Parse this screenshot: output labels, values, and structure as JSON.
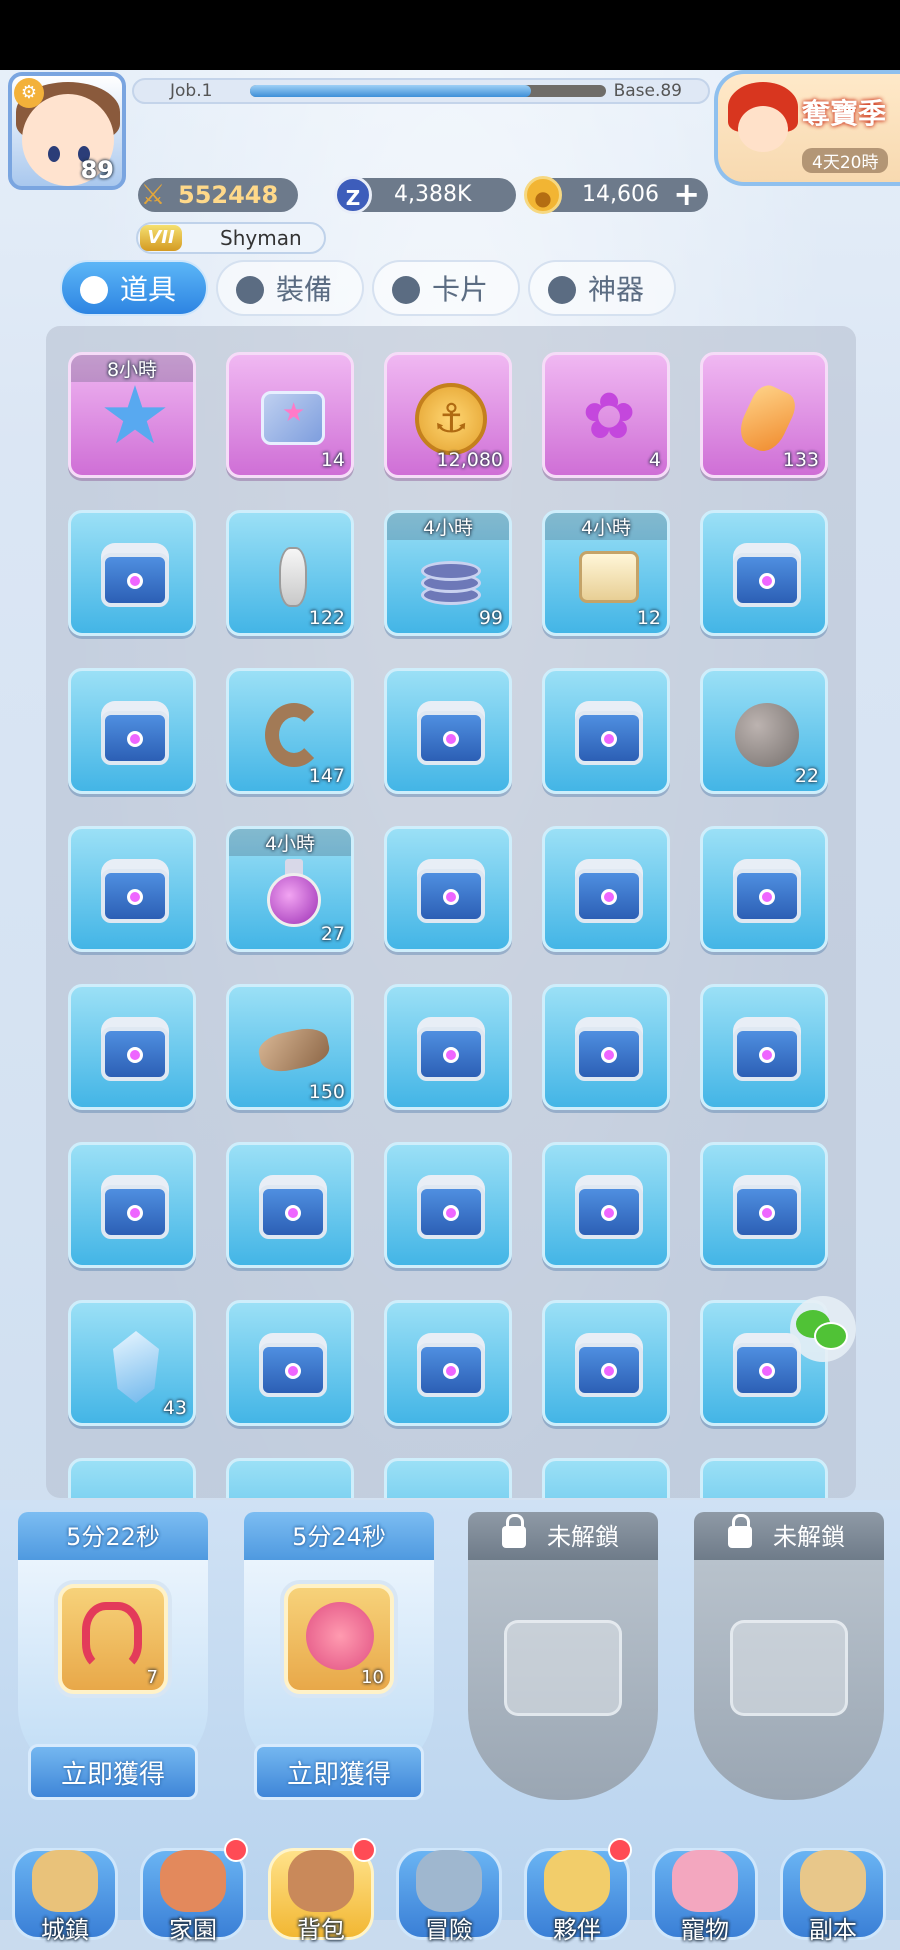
{
  "header": {
    "level": "89",
    "job_label": "Job.1",
    "base_label": "Base.89",
    "exp_progress": 0.79,
    "power": "552448",
    "zeny": "4,388K",
    "gold": "14,606",
    "plus_label": "+",
    "vip_label": "VII",
    "player_name": "Shyman",
    "event_title": "奪寶季",
    "event_timer": "4天20時"
  },
  "tabs": [
    {
      "label": "道具",
      "active": true
    },
    {
      "label": "裝備",
      "active": false
    },
    {
      "label": "卡片",
      "active": false
    },
    {
      "label": "神器",
      "active": false
    }
  ],
  "inventory": {
    "items": [
      {
        "type": "star",
        "color": "purple",
        "timer": "8小時",
        "count": ""
      },
      {
        "type": "ticket",
        "color": "purple",
        "timer": "",
        "count": "14"
      },
      {
        "type": "coin",
        "color": "purple",
        "timer": "",
        "count": "12,080"
      },
      {
        "type": "paw",
        "color": "purple",
        "timer": "",
        "count": "4"
      },
      {
        "type": "gem",
        "color": "purple",
        "timer": "",
        "count": "133"
      },
      {
        "type": "chest",
        "color": "blue",
        "timer": "",
        "count": ""
      },
      {
        "type": "amulet",
        "color": "blue",
        "timer": "",
        "count": "122"
      },
      {
        "type": "coins",
        "color": "blue",
        "timer": "4小時",
        "count": "99"
      },
      {
        "type": "scroll",
        "color": "blue",
        "timer": "4小時",
        "count": "12"
      },
      {
        "type": "chest",
        "color": "blue",
        "timer": "",
        "count": ""
      },
      {
        "type": "chest",
        "color": "blue",
        "timer": "",
        "count": ""
      },
      {
        "type": "horn",
        "color": "blue",
        "timer": "",
        "count": "147"
      },
      {
        "type": "chest",
        "color": "blue",
        "timer": "",
        "count": ""
      },
      {
        "type": "chest",
        "color": "blue",
        "timer": "",
        "count": ""
      },
      {
        "type": "stone",
        "color": "blue",
        "timer": "",
        "count": "22"
      },
      {
        "type": "chest",
        "color": "blue",
        "timer": "",
        "count": ""
      },
      {
        "type": "potion",
        "color": "blue",
        "timer": "4小時",
        "count": "27"
      },
      {
        "type": "chest",
        "color": "blue",
        "timer": "",
        "count": ""
      },
      {
        "type": "chest",
        "color": "blue",
        "timer": "",
        "count": ""
      },
      {
        "type": "chest",
        "color": "blue",
        "timer": "",
        "count": ""
      },
      {
        "type": "chest",
        "color": "blue",
        "timer": "",
        "count": ""
      },
      {
        "type": "fur",
        "color": "blue",
        "timer": "",
        "count": "150"
      },
      {
        "type": "chest",
        "color": "blue",
        "timer": "",
        "count": ""
      },
      {
        "type": "chest",
        "color": "blue",
        "timer": "",
        "count": ""
      },
      {
        "type": "chest",
        "color": "blue",
        "timer": "",
        "count": ""
      },
      {
        "type": "chest",
        "color": "blue",
        "timer": "",
        "count": ""
      },
      {
        "type": "chest",
        "color": "blue",
        "timer": "",
        "count": ""
      },
      {
        "type": "chest",
        "color": "blue",
        "timer": "",
        "count": ""
      },
      {
        "type": "chest",
        "color": "blue",
        "timer": "",
        "count": ""
      },
      {
        "type": "chest",
        "color": "blue",
        "timer": "",
        "count": ""
      },
      {
        "type": "crystal",
        "color": "blue",
        "timer": "",
        "count": "43"
      },
      {
        "type": "chest",
        "color": "blue",
        "timer": "",
        "count": ""
      },
      {
        "type": "chest",
        "color": "blue",
        "timer": "",
        "count": ""
      },
      {
        "type": "chest",
        "color": "blue",
        "timer": "",
        "count": ""
      },
      {
        "type": "chest",
        "color": "blue",
        "timer": "",
        "count": ""
      }
    ]
  },
  "chest_slots": [
    {
      "timer": "5分22秒",
      "count": "7",
      "button": "立即獲得",
      "locked": false,
      "item": "knot"
    },
    {
      "timer": "5分24秒",
      "count": "10",
      "button": "立即獲得",
      "locked": false,
      "item": "flower"
    },
    {
      "timer": "未解鎖",
      "locked": true
    },
    {
      "timer": "未解鎖",
      "locked": true
    }
  ],
  "nav": [
    {
      "label": "城鎮",
      "dot": false,
      "active": false
    },
    {
      "label": "家園",
      "dot": true,
      "active": false
    },
    {
      "label": "背包",
      "dot": true,
      "active": true
    },
    {
      "label": "冒險",
      "dot": false,
      "active": false
    },
    {
      "label": "夥伴",
      "dot": true,
      "active": false
    },
    {
      "label": "寵物",
      "dot": false,
      "active": false
    },
    {
      "label": "副本",
      "dot": false,
      "active": false
    }
  ]
}
